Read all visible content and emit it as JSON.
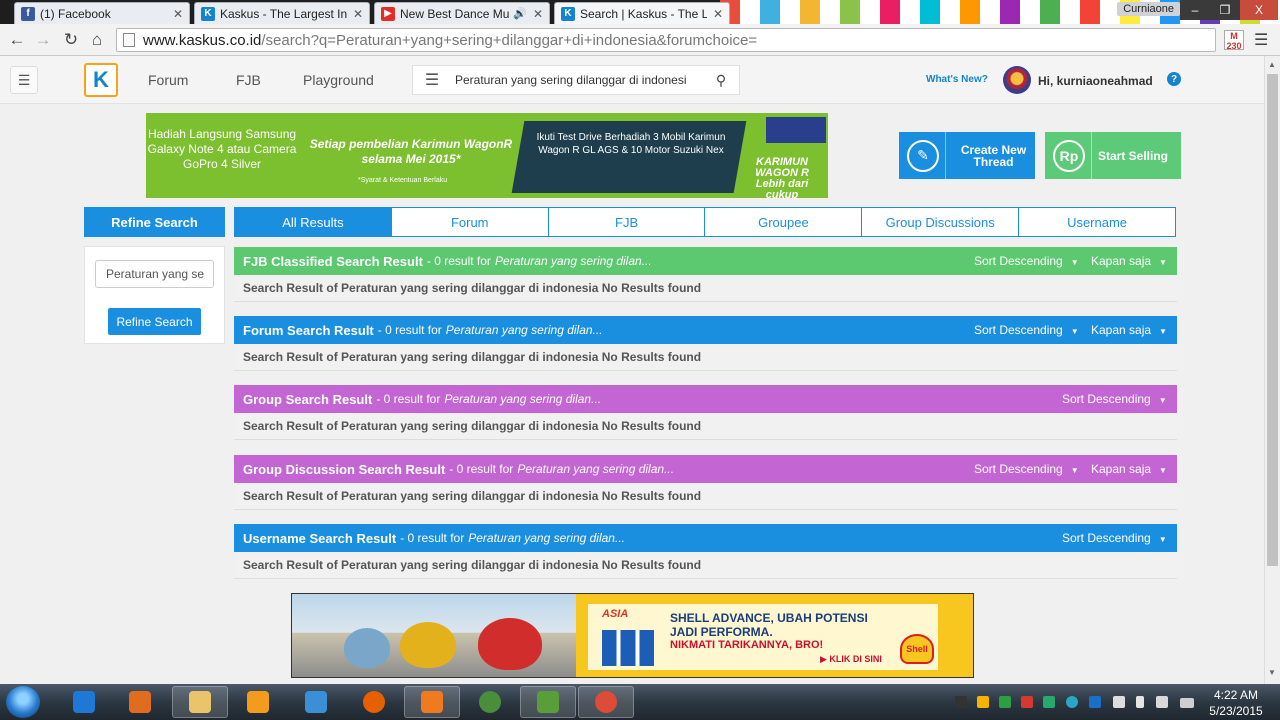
{
  "browser": {
    "tabs": [
      {
        "title": "(1) Facebook",
        "favicon": "facebook-icon",
        "color": "#3b5998",
        "glyph": "f"
      },
      {
        "title": "Kaskus - The Largest Indo",
        "favicon": "kaskus-icon",
        "color": "#1484ce",
        "glyph": "K"
      },
      {
        "title": "New Best Dance Music",
        "favicon": "youtube-icon",
        "color": "#e52d27",
        "glyph": "▶"
      },
      {
        "title": "Search | Kaskus - The Larg",
        "favicon": "kaskus-icon",
        "color": "#1484ce",
        "glyph": "K"
      }
    ],
    "profile_name": "Curniaone",
    "window_controls": {
      "minimize": "–",
      "restore": "❐",
      "close": "X"
    },
    "url_host": "www.kaskus.co.id",
    "url_path": "/search?q=Peraturan+yang+sering+dilanggar+di+indonesia&forumchoice=",
    "gmail_count": "230"
  },
  "header": {
    "nav": [
      "Forum",
      "FJB",
      "Playground"
    ],
    "search_value": "Peraturan yang sering dilanggar di indonesi",
    "whats_new": "What's New?",
    "greeting": "Hi, kurniaoneahmad",
    "help_glyph": "?"
  },
  "banner": {
    "left_text": "Hadiah Langsung Samsung Galaxy Note 4 atau Camera GoPro 4 Silver",
    "promo_text": "Setiap pembelian Karimun WagonR selama Mei 2015*",
    "terms": "*Syarat & Ketentuan Berlaku",
    "prize_text": "Ikuti Test Drive Berhadiah 3 Mobil Karimun Wagon R GL AGS & 10 Motor Suzuki Nex",
    "brand_text": "KARIMUN WAGON R Lebih dari cukup"
  },
  "actions": {
    "create_thread": "Create New Thread",
    "start_selling": "Start Selling",
    "sell_glyph": "Rp"
  },
  "sidebar": {
    "title": "Refine Search",
    "input_value": "Peraturan yang se",
    "button": "Refine Search"
  },
  "result_tabs": [
    "All Results",
    "Forum",
    "FJB",
    "Groupee",
    "Group Discussions",
    "Username"
  ],
  "sections": [
    {
      "title": "FJB Classified Search Result",
      "count": "- 0 result for",
      "query": "Peraturan yang sering dilan...",
      "sort": "Sort Descending",
      "time": "Kapan saja",
      "body": "Search Result of Peraturan yang sering dilanggar di indonesia No Results found",
      "color": "#5cc971"
    },
    {
      "title": "Forum Search Result",
      "count": "- 0 result for",
      "query": "Peraturan yang sering dilan...",
      "sort": "Sort Descending",
      "time": "Kapan saja",
      "body": "Search Result of Peraturan yang sering dilanggar di indonesia No Results found",
      "color": "#1a8fe0"
    },
    {
      "title": "Group Search Result",
      "count": "- 0 result for",
      "query": "Peraturan yang sering dilan...",
      "sort": "Sort Descending",
      "time": "",
      "body": "Search Result of Peraturan yang sering dilanggar di indonesia No Results found",
      "color": "#c366d3"
    },
    {
      "title": "Group Discussion Search Result",
      "count": "- 0 result for",
      "query": "Peraturan yang sering dilan...",
      "sort": "Sort Descending",
      "time": "Kapan saja",
      "body": "Search Result of Peraturan yang sering dilanggar di indonesia No Results found",
      "color": "#c366d3"
    },
    {
      "title": "Username Search Result",
      "count": "- 0 result for",
      "query": "Peraturan yang sering dilan...",
      "sort": "Sort Descending",
      "time": "",
      "body": "Search Result of Peraturan yang sering dilanggar di indonesia No Results found",
      "color": "#1a8fe0"
    }
  ],
  "bottom_ad": {
    "brand": "ASIA",
    "headline": "SHELL ADVANCE, UBAH POTENSI JADI PERFORMA.",
    "subline": "NIKMATI TARIKANNYA, BRO!",
    "cta": "KLIK DI SINI",
    "logo_text": "Shell"
  },
  "taskbar": {
    "time": "4:22 AM",
    "date": "5/23/2015",
    "apps": [
      "internet-explorer-icon",
      "media-player-icon",
      "file-explorer-icon",
      "avast-icon",
      "control-panel-icon",
      "firefox-icon",
      "uc-browser-icon",
      "chrome-icon",
      "task-manager-icon",
      "chrome-icon"
    ]
  }
}
